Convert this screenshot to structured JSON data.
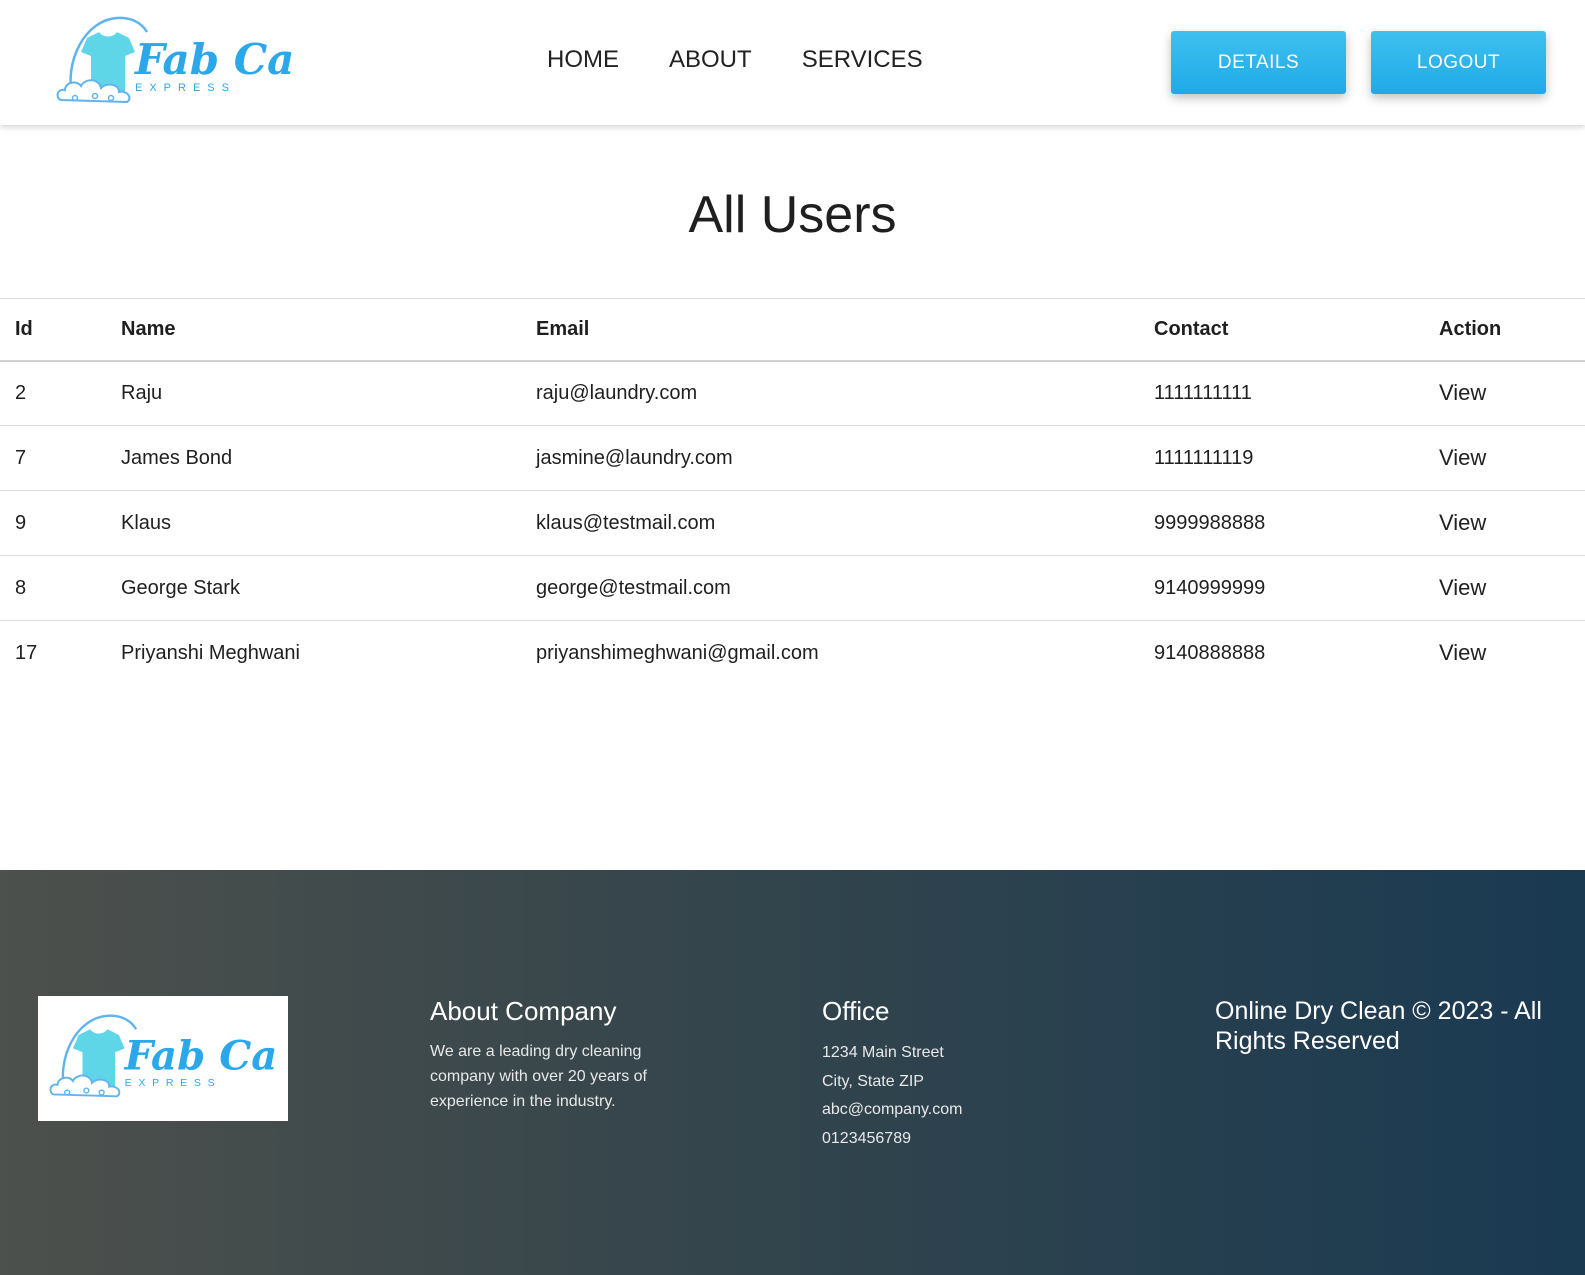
{
  "header": {
    "logo": {
      "title": "Fab Care",
      "subtitle": "EXPRESS"
    },
    "nav": [
      "HOME",
      "ABOUT",
      "SERVICES"
    ],
    "details_label": "DETAILS",
    "logout_label": "LOGOUT",
    "colors": {
      "accent": "#29b6f0",
      "logo_shirt": "#5fd6e8",
      "logo_text": "#2aa8ea"
    }
  },
  "main": {
    "title": "All Users",
    "table": {
      "columns": [
        "Id",
        "Name",
        "Email",
        "Contact",
        "Action"
      ],
      "rows": [
        {
          "id": "2",
          "name": "Raju",
          "email": "raju@laundry.com",
          "contact": "1111111111",
          "action": "View"
        },
        {
          "id": "7",
          "name": "James Bond",
          "email": "jasmine@laundry.com",
          "contact": "1111111119",
          "action": "View"
        },
        {
          "id": "9",
          "name": "Klaus",
          "email": "klaus@testmail.com",
          "contact": "9999988888",
          "action": "View"
        },
        {
          "id": "8",
          "name": "George Stark",
          "email": "george@testmail.com",
          "contact": "9140999999",
          "action": "View"
        },
        {
          "id": "17",
          "name": "Priyanshi Meghwani",
          "email": "priyanshimeghwani@gmail.com",
          "contact": "9140888888",
          "action": "View"
        }
      ]
    }
  },
  "footer": {
    "logo": {
      "title": "Fab Care",
      "subtitle": "EXPRESS"
    },
    "about": {
      "heading": "About Company",
      "text": "We are a leading dry cleaning company with over 20 years of experience in the industry."
    },
    "office": {
      "heading": "Office",
      "lines": [
        "1234 Main Street",
        "City, State ZIP",
        "abc@company.com",
        "0123456789"
      ]
    },
    "copyright": "Online Dry Clean © 2023 - All Rights Reserved"
  }
}
